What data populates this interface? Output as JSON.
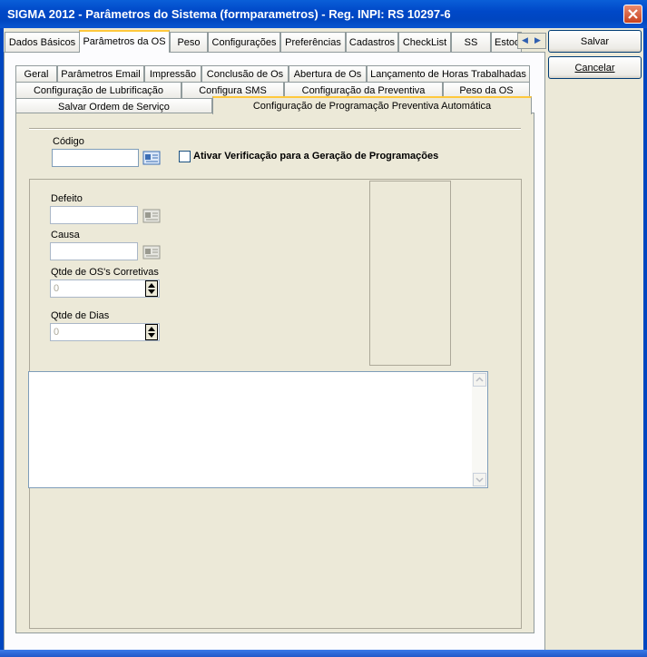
{
  "window": {
    "title": "SIGMA 2012 - Parâmetros do Sistema  (formparametros)  - Reg. INPI: RS 10297-6"
  },
  "top_tabs": [
    {
      "label": "Dados Básicos"
    },
    {
      "label": "Parâmetros da OS"
    },
    {
      "label": "Peso"
    },
    {
      "label": "Configurações"
    },
    {
      "label": "Preferências"
    },
    {
      "label": "Cadastros"
    },
    {
      "label": "CheckList"
    },
    {
      "label": "SS"
    },
    {
      "label": "Estoq"
    }
  ],
  "side_buttons": {
    "save_label": "Salvar",
    "cancel_label": "Cancelar"
  },
  "sub_tabs": {
    "row1": [
      {
        "label": "Geral"
      },
      {
        "label": "Parâmetros Email"
      },
      {
        "label": "Impressão"
      },
      {
        "label": "Conclusão de Os"
      },
      {
        "label": "Abertura de Os"
      },
      {
        "label": "Lançamento de Horas Trabalhadas"
      }
    ],
    "row2": [
      {
        "label": "Configuração de Lubrificação"
      },
      {
        "label": "Configura SMS"
      },
      {
        "label": "Configuração da Preventiva"
      },
      {
        "label": "Peso da OS"
      }
    ],
    "row3": [
      {
        "label": "Salvar Ordem de Serviço"
      },
      {
        "label": "Configuração de Programação Preventiva Automática"
      }
    ]
  },
  "form": {
    "codigo_label": "Código",
    "codigo_value": "",
    "ativar_label": "Ativar Verificação para a Geração de Programações",
    "ativar_checked": false,
    "defeito_label": "Defeito",
    "defeito_value": "",
    "causa_label": "Causa",
    "causa_value": "",
    "qtde_corretivas_label": "Qtde de OS's Corretivas",
    "qtde_corretivas_value": "0",
    "qtde_dias_label": "Qtde de Dias",
    "qtde_dias_value": "0",
    "memo_value": ""
  },
  "colors": {
    "titlebar": "#0046c0",
    "tab_highlight": "#ffc83c",
    "window_bg": "#ece9d8"
  }
}
